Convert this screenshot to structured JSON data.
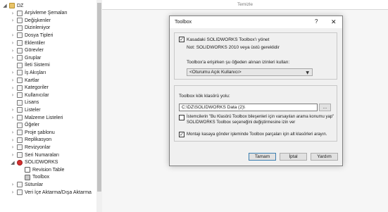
{
  "tree": {
    "items": [
      {
        "label": "DZ",
        "arrow": "◢",
        "icon": "folder-icon",
        "depth": 0
      },
      {
        "label": "Arşivleme Şemaları",
        "arrow": "›",
        "icon": "archive-icon",
        "depth": 1
      },
      {
        "label": "Değişkenler",
        "arrow": "›",
        "icon": "variables-icon",
        "depth": 1
      },
      {
        "label": "Dizinleniyor",
        "arrow": "",
        "icon": "index-icon",
        "depth": 1
      },
      {
        "label": "Dosya Tipleri",
        "arrow": "›",
        "icon": "file-types-icon",
        "depth": 1
      },
      {
        "label": "Eklentiler",
        "arrow": "›",
        "icon": "addins-icon",
        "depth": 1
      },
      {
        "label": "Görevler",
        "arrow": "›",
        "icon": "tasks-icon",
        "depth": 1
      },
      {
        "label": "Gruplar",
        "arrow": "›",
        "icon": "groups-icon",
        "depth": 1
      },
      {
        "label": "İleti Sistemi",
        "arrow": "",
        "icon": "message-icon",
        "depth": 1
      },
      {
        "label": "İş Akışları",
        "arrow": "›",
        "icon": "workflow-icon",
        "depth": 1
      },
      {
        "label": "Kartlar",
        "arrow": "›",
        "icon": "cards-icon",
        "depth": 1
      },
      {
        "label": "Kategoriler",
        "arrow": "›",
        "icon": "categories-icon",
        "depth": 1
      },
      {
        "label": "Kullanıcılar",
        "arrow": "›",
        "icon": "users-icon",
        "depth": 1
      },
      {
        "label": "Lisans",
        "arrow": "",
        "icon": "license-icon",
        "depth": 1
      },
      {
        "label": "Listeler",
        "arrow": "›",
        "icon": "lists-icon",
        "depth": 1
      },
      {
        "label": "Malzeme Listeleri",
        "arrow": "›",
        "icon": "bom-icon",
        "depth": 1
      },
      {
        "label": "Öğeler",
        "arrow": "",
        "icon": "items-icon",
        "depth": 1
      },
      {
        "label": "Proje şablonu",
        "arrow": "›",
        "icon": "project-template-icon",
        "depth": 1
      },
      {
        "label": "Replikasyon",
        "arrow": "›",
        "icon": "replication-icon",
        "depth": 1
      },
      {
        "label": "Revizyonlar",
        "arrow": "›",
        "icon": "revisions-icon",
        "depth": 1
      },
      {
        "label": "Seri Numaraları",
        "arrow": "›",
        "icon": "serial-numbers-icon",
        "depth": 1
      },
      {
        "label": "SOLIDWORKS",
        "arrow": "◢",
        "icon": "solidworks-icon",
        "depth": 1
      },
      {
        "label": "Revision Table",
        "arrow": "",
        "icon": "revision-table-icon",
        "depth": 2
      },
      {
        "label": "Toolbox",
        "arrow": "",
        "icon": "toolbox-icon",
        "depth": 2
      },
      {
        "label": "Sütunlar",
        "arrow": "›",
        "icon": "columns-icon",
        "depth": 1
      },
      {
        "label": "Veri İçe Aktarma/Dışa Aktarma",
        "arrow": "›",
        "icon": "import-export-icon",
        "depth": 1
      }
    ]
  },
  "header": {
    "text": "Temizle"
  },
  "dialog": {
    "title": "Toolbox",
    "help_glyph": "?",
    "close_glyph": "✕",
    "manage_label": "Kasadaki SOLIDWORKS Toolbox'ı yönet",
    "manage_checked": true,
    "note": "Not: SOLIDWORKS 2010 veya üstü gereklidir",
    "perm_label": "Toolbox'a erişirken şu öğeden alınan izinleri kullan:",
    "perm_value": "<Oturumu Açık Kullanıcı>",
    "folder_label": "Toolbox kök klasörü yolu:",
    "folder_value": "C:\\DZ\\SOLIDWORKS Data (2)\\",
    "browse_label": "...",
    "prompt_label_1": "İstemcilerin \"Bu Klasörü Toolbox bileşenleri için varsayılan arama konumu yap\"",
    "prompt_label_2": "SOLIDWORKS Toolbox seçeneğini değiştirmesine izin ver",
    "prompt_checked": false,
    "scan_label": "Montajı kasaya gönder işleminde Toolbox parçaları için alt klasörleri arayın.",
    "scan_checked": true,
    "ok_label": "Tamam",
    "cancel_label": "İptal",
    "help_label": "Yardım"
  },
  "colors": {
    "accent": "#3c7fb1",
    "solidworks_red": "#d32f2f"
  }
}
